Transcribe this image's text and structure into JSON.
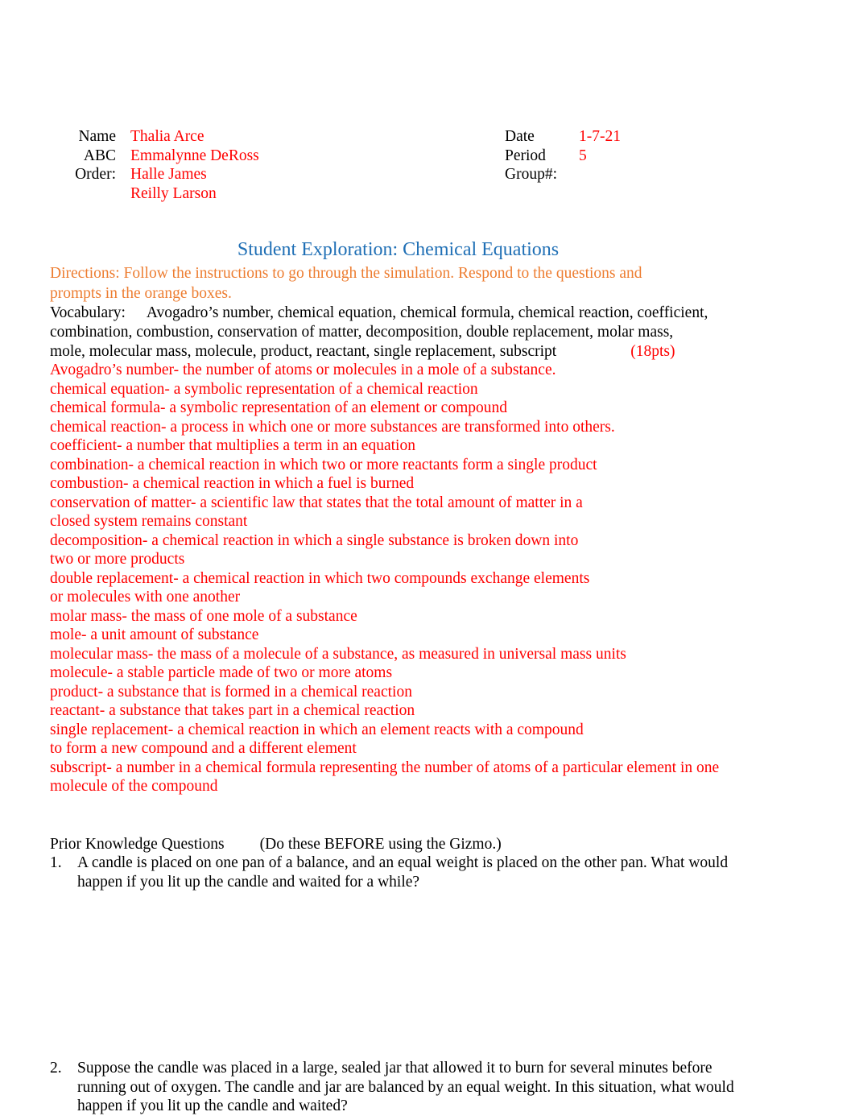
{
  "header": {
    "left_rows": [
      {
        "label": "Name",
        "value": "Thalia Arce"
      },
      {
        "label": "ABC",
        "value": "Emmalynne DeRoss"
      },
      {
        "label": "Order:",
        "value": "Halle James"
      },
      {
        "label": "",
        "value": "Reilly Larson"
      }
    ],
    "right_rows": [
      {
        "label": "Date",
        "value": "1-7-21"
      },
      {
        "label": "Period",
        "value": "5"
      },
      {
        "label": "Group#:",
        "value": ""
      }
    ]
  },
  "title": "Student Exploration: Chemical Equations",
  "directions": "Directions: Follow the instructions to go through the simulation. Respond to the questions and prompts in the orange boxes.",
  "vocabulary": {
    "label": "Vocabulary:",
    "terms": "Avogadro’s number, chemical equation, chemical formula, chemical reaction, coefficient, combination, combustion, conservation of matter, decomposition, double replacement, molar mass, mole, molecular mass, molecule, product, reactant, single replacement, subscript",
    "points": "(18pts)"
  },
  "definitions": [
    "Avogadro’s number- the number of atoms or molecules in a mole of a substance.",
    "chemical equation- a symbolic representation of a chemical reaction",
    "chemical formula- a symbolic representation of an element or compound",
    "chemical reaction- a process in which one or more substances are transformed into others.",
    "coefficient- a number that multiplies a term in an equation",
    "combination- a chemical reaction in which two or more reactants form a single product",
    "combustion- a chemical reaction in which a fuel is burned",
    "conservation of matter- a scientific law that states that the total amount of matter in a",
    "closed system remains constant",
    "decomposition- a chemical reaction in which a single substance is broken down into",
    "two or more products",
    "double replacement- a chemical reaction in which two compounds exchange elements",
    "or molecules with one another",
    "molar mass- the mass of one mole of a substance",
    "mole- a unit amount of substance",
    "molecular mass- the mass of a molecule of a substance, as measured in universal mass units",
    "molecule- a stable particle made of two or more atoms",
    "product- a substance that is formed in a chemical reaction",
    "reactant- a substance that takes part in a chemical reaction",
    "single replacement- a chemical reaction in which an element reacts with a compound",
    "to form a new compound and a different element",
    "subscript- a number in a chemical formula representing the number of atoms of a particular element in one",
    "molecule of the compound"
  ],
  "prior_knowledge": {
    "heading": "Prior Knowledge Questions",
    "note": "(Do these BEFORE using the Gizmo.)",
    "questions": [
      {
        "number": "1.",
        "text": "A candle is placed on one pan of a balance, and an equal weight is placed on the other pan. What would happen if you lit up the candle and waited for a while?"
      },
      {
        "number": "2.",
        "text": "Suppose the candle was placed in a large, sealed jar that allowed it to burn for several minutes before running out of oxygen. The candle and jar are balanced by an equal weight. In this situation, what would happen if you lit up the candle and waited?"
      }
    ]
  },
  "colors": {
    "title_blue": "#1F6FB5",
    "directions_orange": "#ED7D31",
    "answer_red": "#FF0000",
    "body_black": "#000000"
  }
}
